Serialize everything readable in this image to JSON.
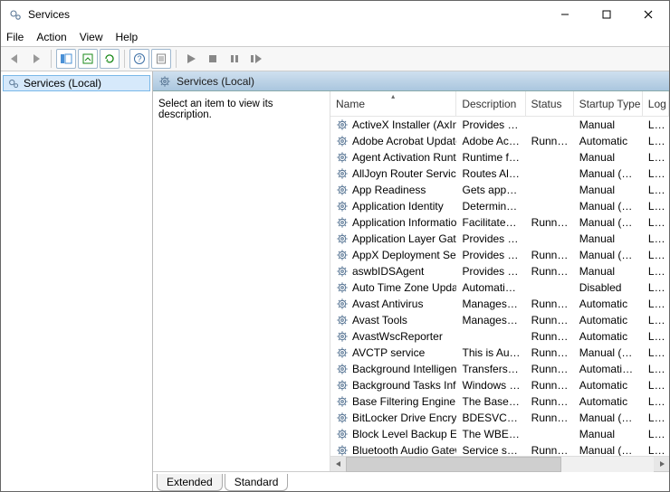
{
  "window": {
    "title": "Services"
  },
  "menus": [
    "File",
    "Action",
    "View",
    "Help"
  ],
  "tree": {
    "root_label": "Services (Local)"
  },
  "main_header": "Services (Local)",
  "detail_hint": "Select an item to view its description.",
  "columns": {
    "name": "Name",
    "description": "Description",
    "status": "Status",
    "startup": "Startup Type",
    "logon": "Log"
  },
  "logon_value": "Loca",
  "tabs": {
    "extended": "Extended",
    "standard": "Standard"
  },
  "services": [
    {
      "name": "ActiveX Installer (AxInstSV)",
      "desc": "Provides Us...",
      "status": "",
      "startup": "Manual"
    },
    {
      "name": "Adobe Acrobat Update Serv...",
      "desc": "Adobe Acro...",
      "status": "Running",
      "startup": "Automatic"
    },
    {
      "name": "Agent Activation Runtime_...",
      "desc": "Runtime for...",
      "status": "",
      "startup": "Manual"
    },
    {
      "name": "AllJoyn Router Service",
      "desc": "Routes AllJo...",
      "status": "",
      "startup": "Manual (Trig..."
    },
    {
      "name": "App Readiness",
      "desc": "Gets apps re...",
      "status": "",
      "startup": "Manual"
    },
    {
      "name": "Application Identity",
      "desc": "Determines ...",
      "status": "",
      "startup": "Manual (Trig..."
    },
    {
      "name": "Application Information",
      "desc": "Facilitates t...",
      "status": "Running",
      "startup": "Manual (Trig..."
    },
    {
      "name": "Application Layer Gateway ...",
      "desc": "Provides su...",
      "status": "",
      "startup": "Manual"
    },
    {
      "name": "AppX Deployment Service (...",
      "desc": "Provides inf...",
      "status": "Running",
      "startup": "Manual (Trig..."
    },
    {
      "name": "aswbIDSAgent",
      "desc": "Provides Ide...",
      "status": "Running",
      "startup": "Manual"
    },
    {
      "name": "Auto Time Zone Updater",
      "desc": "Automatica...",
      "status": "",
      "startup": "Disabled"
    },
    {
      "name": "Avast Antivirus",
      "desc": "Manages an...",
      "status": "Running",
      "startup": "Automatic"
    },
    {
      "name": "Avast Tools",
      "desc": "Manages an...",
      "status": "Running",
      "startup": "Automatic"
    },
    {
      "name": "AvastWscReporter",
      "desc": "",
      "status": "Running",
      "startup": "Automatic"
    },
    {
      "name": "AVCTP service",
      "desc": "This is Audi...",
      "status": "Running",
      "startup": "Manual (Trig..."
    },
    {
      "name": "Background Intelligent Tran...",
      "desc": "Transfers fil...",
      "status": "Running",
      "startup": "Automatic (..."
    },
    {
      "name": "Background Tasks Infrastruc...",
      "desc": "Windows in...",
      "status": "Running",
      "startup": "Automatic"
    },
    {
      "name": "Base Filtering Engine",
      "desc": "The Base Fil...",
      "status": "Running",
      "startup": "Automatic"
    },
    {
      "name": "BitLocker Drive Encryption ...",
      "desc": "BDESVC hos...",
      "status": "Running",
      "startup": "Manual (Trig..."
    },
    {
      "name": "Block Level Backup Engine ...",
      "desc": "The WBENG...",
      "status": "",
      "startup": "Manual"
    },
    {
      "name": "Bluetooth Audio Gateway S...",
      "desc": "Service sup...",
      "status": "Running",
      "startup": "Manual (Trig..."
    }
  ]
}
